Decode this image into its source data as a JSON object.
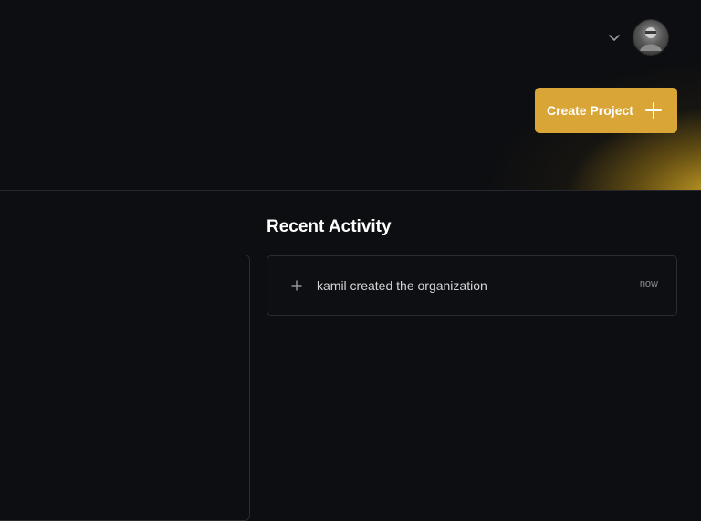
{
  "header": {
    "create_button_label": "Create Project",
    "account_menu_icon": "chevron-down-icon",
    "avatar_icon": "user-avatar",
    "accent_color": "#d9a536"
  },
  "recent_activity": {
    "title": "Recent Activity",
    "items": [
      {
        "icon": "plus-icon",
        "text": "kamil created the organization",
        "time": "now"
      }
    ]
  }
}
